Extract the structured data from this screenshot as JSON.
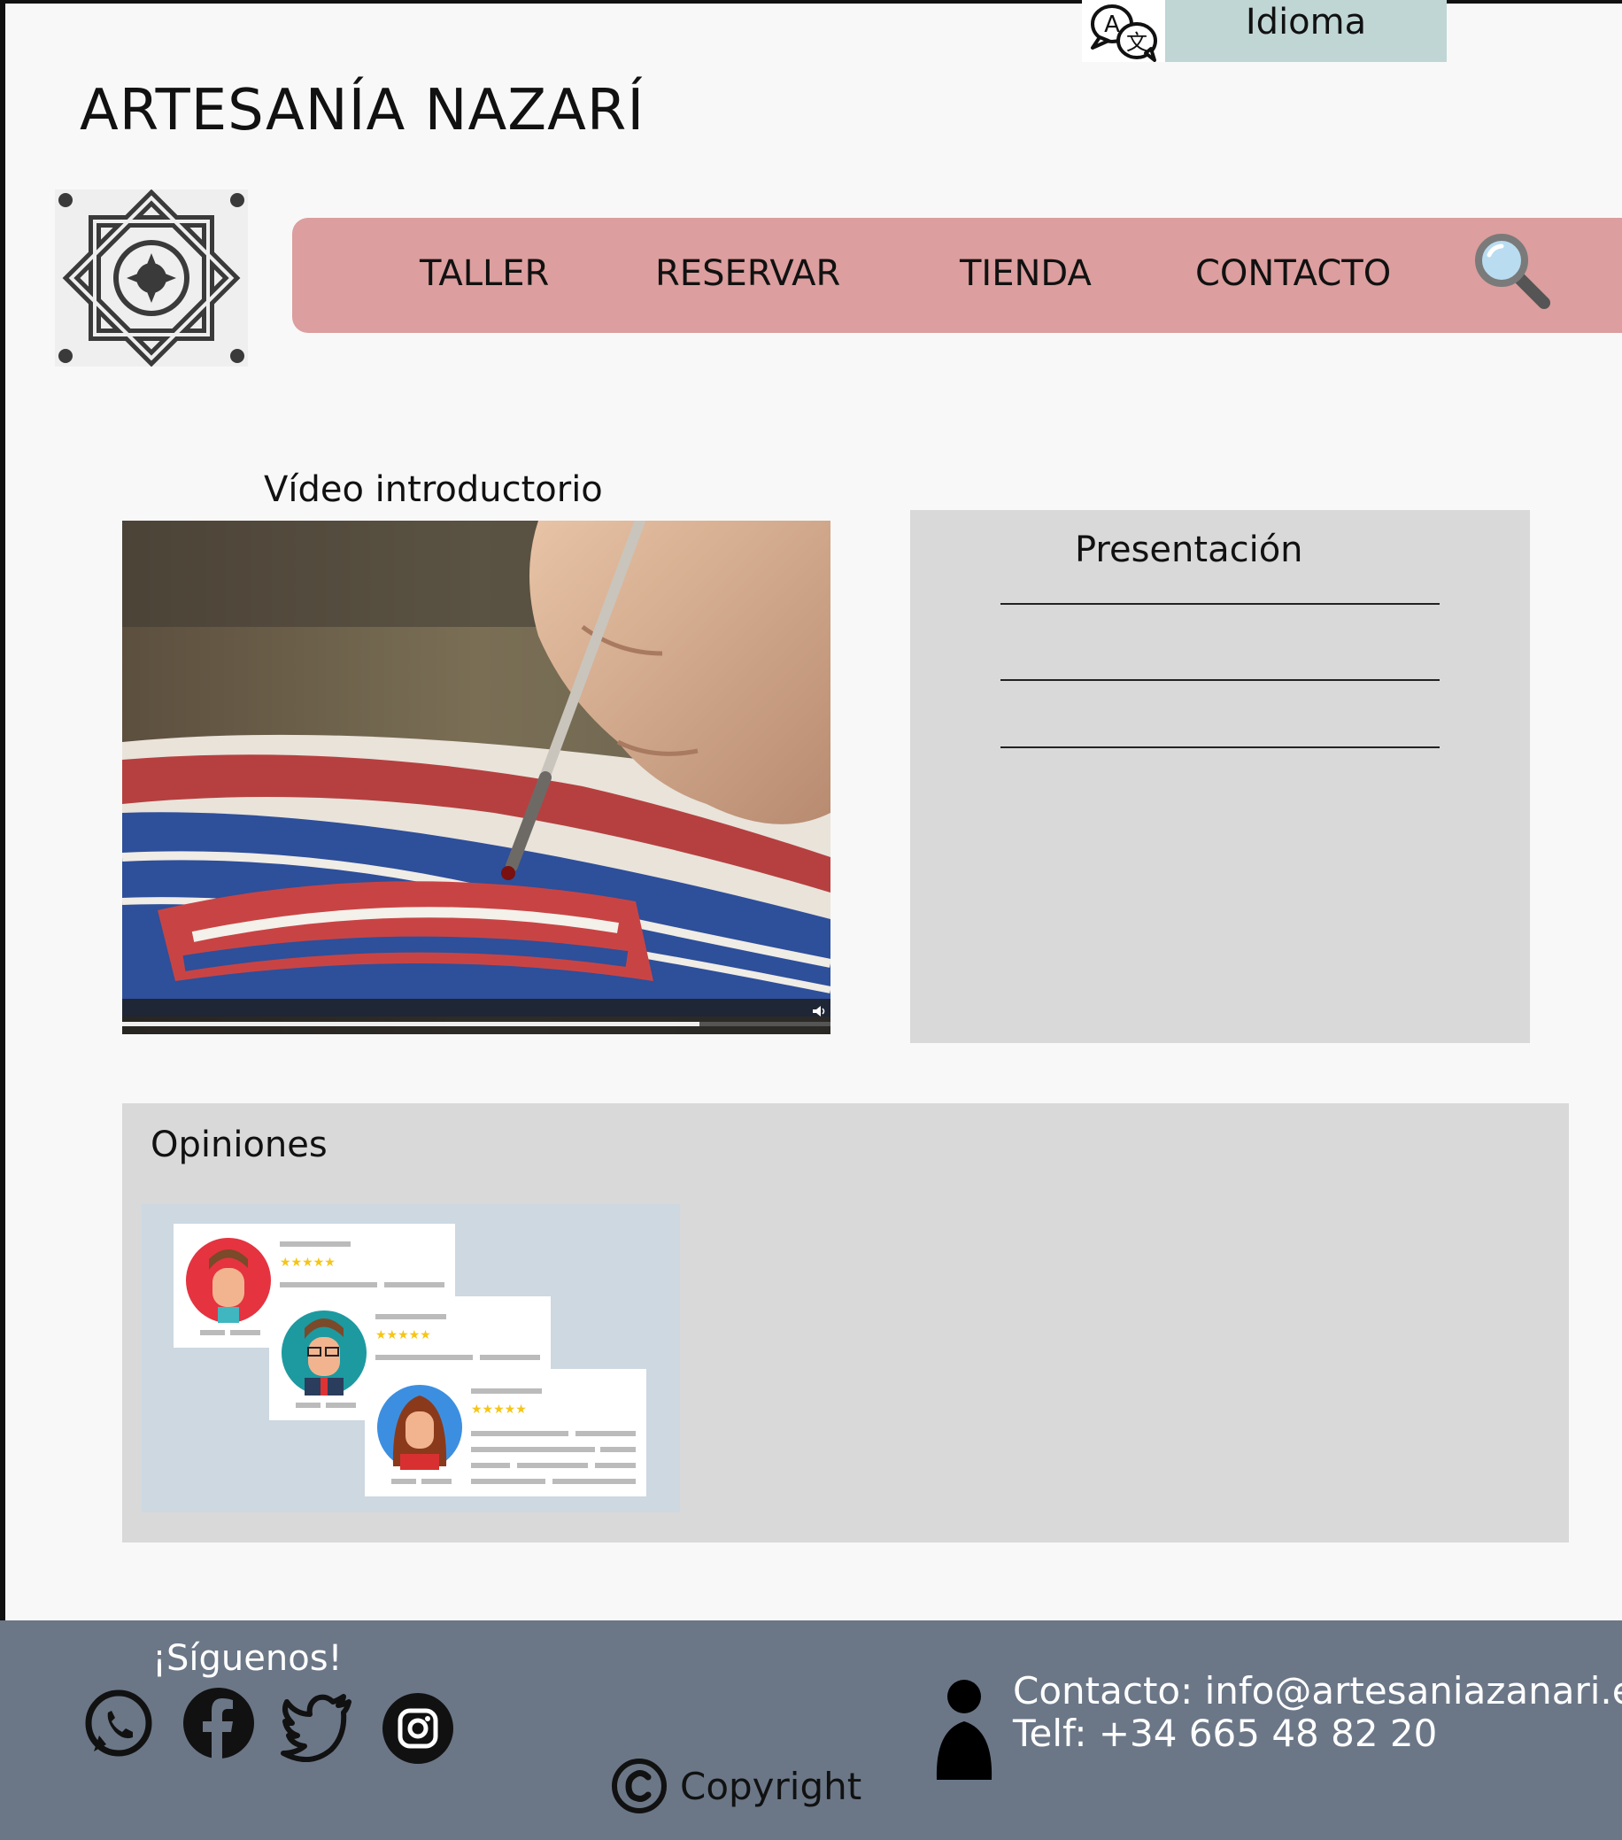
{
  "language": {
    "label": "Idioma",
    "icon": "translate-icon"
  },
  "site": {
    "title": "ARTESANÍA NAZARÍ",
    "logo_icon": "nazari-star-tile-logo"
  },
  "nav": {
    "items": [
      {
        "label": "TALLER"
      },
      {
        "label": "RESERVAR"
      },
      {
        "label": "TIENDA"
      },
      {
        "label": "CONTACTO"
      }
    ],
    "search_icon": "search-icon",
    "background": "#dc9e9e"
  },
  "video": {
    "title": "Vídeo introductorio",
    "progress": 0.815,
    "volume_icon": "volume-icon"
  },
  "presentation": {
    "title": "Presentación"
  },
  "opinions": {
    "title": "Opiniones",
    "stars_per_review": 5
  },
  "footer": {
    "follow_label": "¡Síguenos!",
    "social": [
      "whatsapp-icon",
      "facebook-icon",
      "twitter-icon",
      "instagram-icon"
    ],
    "copyright": "Copyright",
    "contact_email_line": "Contacto: info@artesaniazanari.es",
    "contact_phone_line": "Telf: +34 665 48 82 20",
    "background": "#6b7787"
  },
  "colors": {
    "accent_lang": "#c0d6d4",
    "panel": "#d9d9d9"
  }
}
